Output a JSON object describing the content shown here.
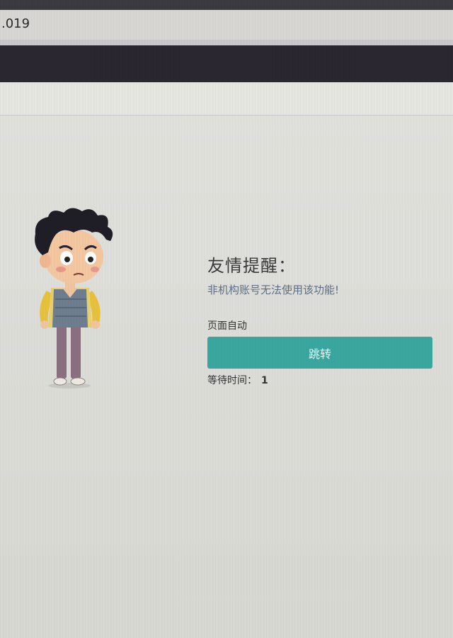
{
  "browser": {
    "address_text": ".019"
  },
  "notice": {
    "title": "友情提醒：",
    "message": "非机构账号无法使用该功能!",
    "auto_label": "页面自动",
    "jump_label": "跳转",
    "wait_label": "等待时间：",
    "wait_value": "1"
  },
  "illustration": {
    "icon": "worried-boy-illustration"
  },
  "colors": {
    "button": "#39a79f",
    "navbar": "#2b2730",
    "message_text": "#5d6f86"
  }
}
